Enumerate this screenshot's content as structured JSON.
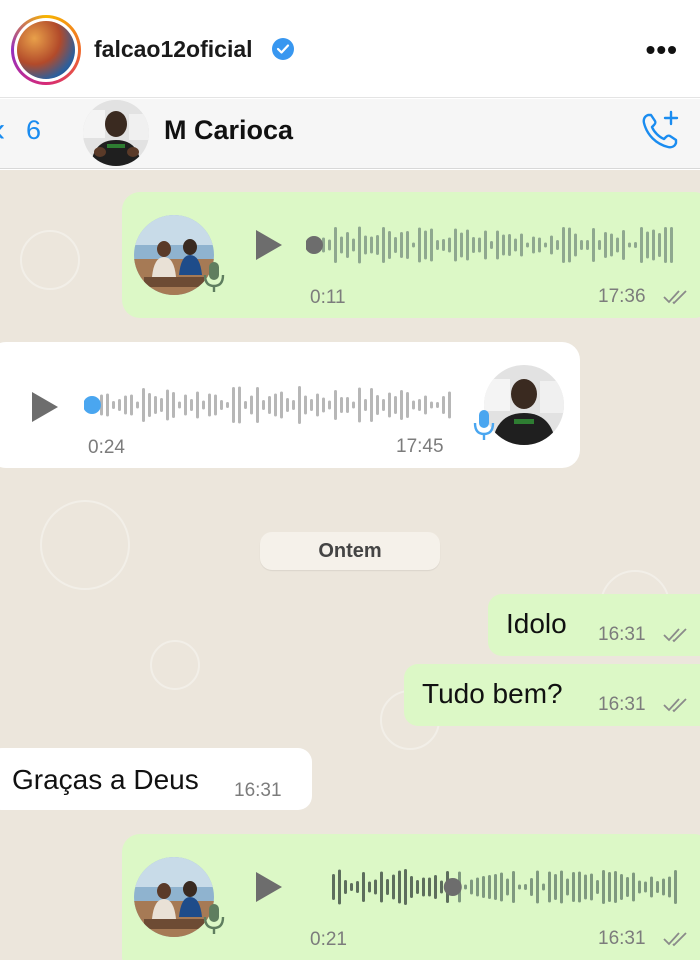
{
  "post": {
    "username": "falcao12oficial",
    "icons": {
      "verified": "verified-badge-icon",
      "more": "more-options-icon"
    },
    "more_glyph": "•••"
  },
  "chat_header": {
    "back_glyph": "‹",
    "back_count": "6",
    "contact_name": "M Carioca",
    "call_icon": "add-call-icon"
  },
  "messages": [
    {
      "kind": "voice",
      "direction": "outgoing",
      "duration": "0:11",
      "time": "17:36",
      "status": "read",
      "progress": 0
    },
    {
      "kind": "voice",
      "direction": "incoming",
      "duration": "0:24",
      "time": "17:45",
      "progress": 0
    },
    {
      "kind": "date",
      "label": "Ontem"
    },
    {
      "kind": "text",
      "direction": "outgoing",
      "text": "Idolo",
      "time": "16:31",
      "status": "read"
    },
    {
      "kind": "text",
      "direction": "outgoing",
      "text": "Tudo bem?",
      "time": "16:31",
      "status": "read"
    },
    {
      "kind": "text",
      "direction": "incoming",
      "text": "Graças a Deus",
      "time": "16:31"
    },
    {
      "kind": "voice",
      "direction": "outgoing",
      "duration": "0:21",
      "time": "16:31",
      "status": "read",
      "progress": 0.37
    }
  ],
  "colors": {
    "outgoing_bubble": "#dcf8c6",
    "incoming_bubble": "#ffffff",
    "chat_background": "#ece6dc",
    "accent_blue": "#1a8cf0",
    "voice_dot_incoming": "#4aa6f0",
    "voice_dot_outgoing": "#6d6d6d"
  }
}
